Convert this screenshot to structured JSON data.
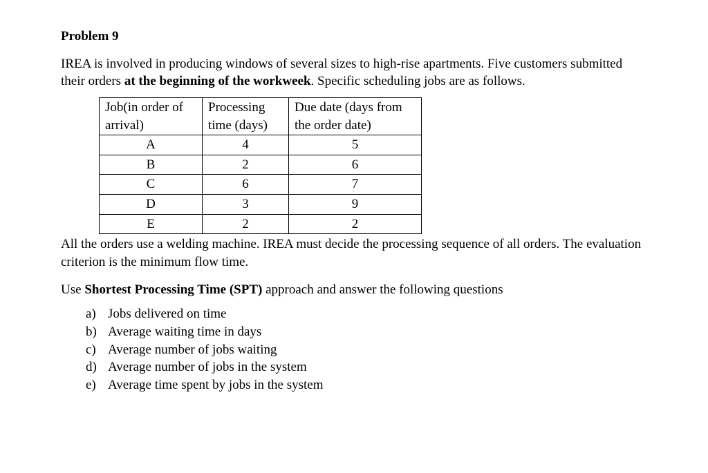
{
  "title": "Problem 9",
  "intro_pre": "IREA is involved in producing windows of several sizes to high-rise apartments. Five customers submitted their orders ",
  "intro_bold": "at the beginning of the workweek",
  "intro_post": ". Specific scheduling jobs are as follows.",
  "table": {
    "headers": {
      "c1a": "Job(in order of",
      "c1b": "arrival)",
      "c2a": "Processing",
      "c2b": "time (days)",
      "c3a": "Due date (days from",
      "c3b": "the order date)"
    },
    "rows": [
      {
        "job": "A",
        "pt": "4",
        "dd": "5"
      },
      {
        "job": "B",
        "pt": "2",
        "dd": "6"
      },
      {
        "job": "C",
        "pt": "6",
        "dd": "7"
      },
      {
        "job": "D",
        "pt": "3",
        "dd": "9"
      },
      {
        "job": "E",
        "pt": "2",
        "dd": "2"
      }
    ]
  },
  "after_table": "All the orders use a welding machine. IREA must decide the processing sequence of all orders. The evaluation criterion is the minimum flow time.",
  "instr_pre": "Use ",
  "instr_bold": "Shortest Processing Time (SPT)",
  "instr_post": " approach and answer the following questions",
  "questions": [
    {
      "letter": "a)",
      "text": "Jobs delivered on time"
    },
    {
      "letter": "b)",
      "text": "Average waiting time in days"
    },
    {
      "letter": "c)",
      "text": "Average number of jobs waiting"
    },
    {
      "letter": "d)",
      "text": "Average number of jobs in the system"
    },
    {
      "letter": "e)",
      "text": "Average time spent by jobs in the system"
    }
  ]
}
